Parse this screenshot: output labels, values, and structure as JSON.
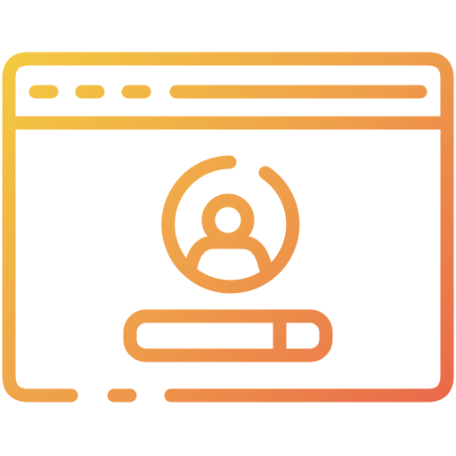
{
  "icon": {
    "name": "browser-user-login-icon",
    "style": "outline",
    "gradient": {
      "start_color": "#F4D03F",
      "mid_color": "#EFA04A",
      "end_color": "#E8604A"
    },
    "elements": {
      "window": "browser-window-frame",
      "toolbar_dots": 3,
      "address_bar": "address-bar",
      "avatar": "user-avatar-icon",
      "login_field": "input-field-with-button"
    }
  }
}
